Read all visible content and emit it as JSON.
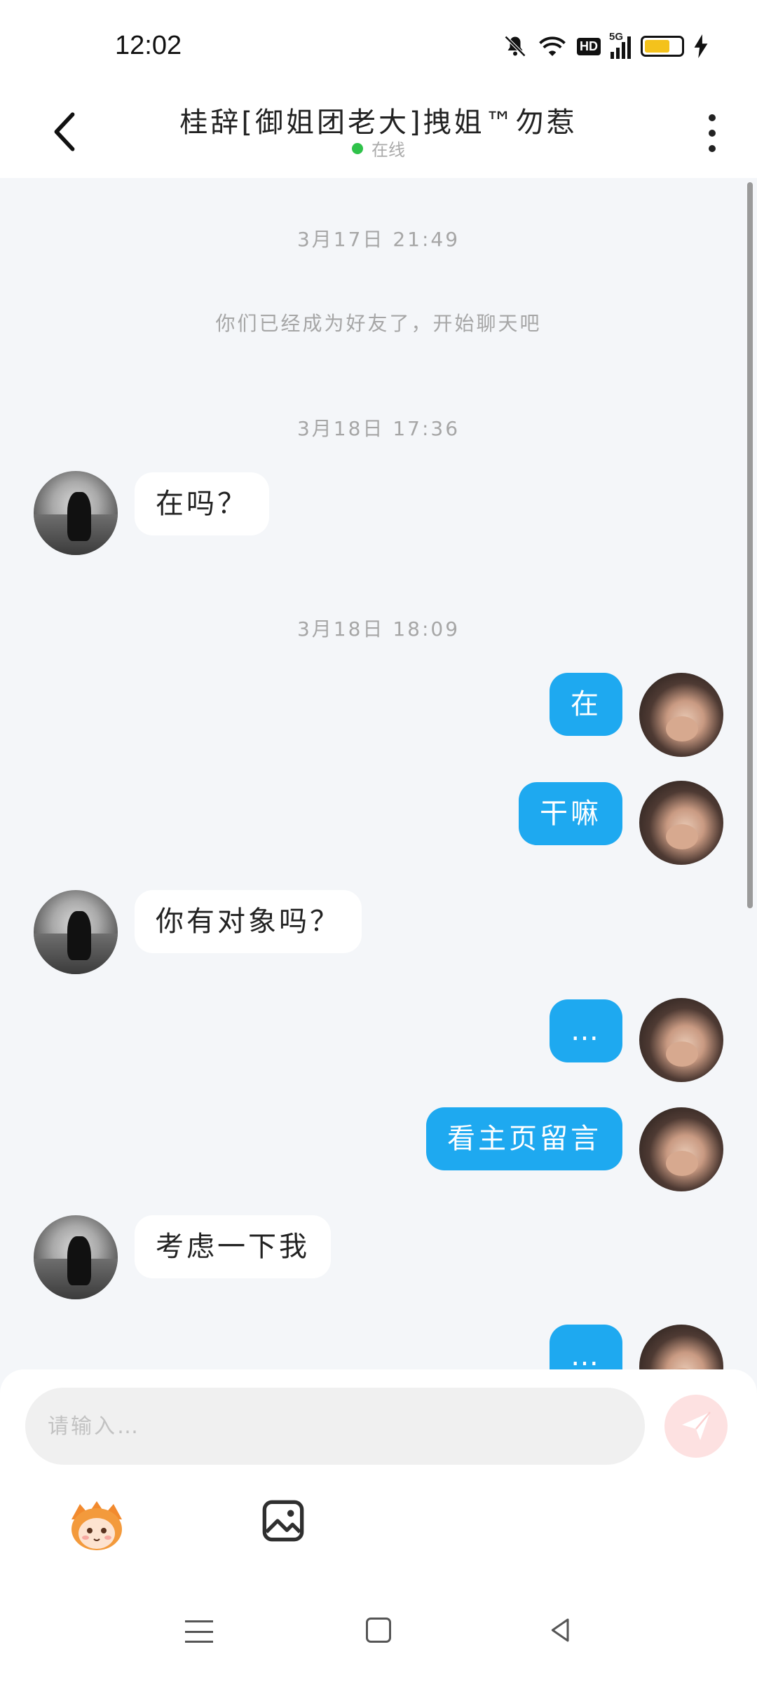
{
  "status_bar": {
    "time": "12:02",
    "icons": [
      "mute-icon",
      "wifi-icon",
      "hd-icon",
      "signal-5g-icon",
      "battery-icon",
      "charging-icon"
    ],
    "hd_label": "HD",
    "network_label": "5G",
    "battery_color": "#f4c21c"
  },
  "header": {
    "title": "桂辞[御姐团老大]拽姐™勿惹",
    "status": "在线",
    "status_color": "#2fc24a"
  },
  "chat": {
    "messages": [
      {
        "type": "timestamp",
        "text": "3月17日 21:49"
      },
      {
        "type": "system",
        "text": "你们已经成为好友了，开始聊天吧"
      },
      {
        "type": "timestamp",
        "text": "3月18日 17:36"
      },
      {
        "type": "incoming",
        "text": "在吗？"
      },
      {
        "type": "timestamp",
        "text": "3月18日 18:09"
      },
      {
        "type": "outgoing",
        "text": "在"
      },
      {
        "type": "outgoing",
        "text": "干嘛"
      },
      {
        "type": "incoming",
        "text": "你有对象吗？"
      },
      {
        "type": "outgoing",
        "text": "…"
      },
      {
        "type": "outgoing",
        "text": "看主页留言"
      },
      {
        "type": "incoming",
        "text": "考虑一下我"
      },
      {
        "type": "outgoing",
        "text": "…"
      }
    ],
    "outgoing_bubble_color": "#1ea9f0",
    "incoming_bubble_color": "#ffffff"
  },
  "composer": {
    "placeholder": "请输入…",
    "send_icon": "send-icon",
    "tools": [
      "emoji-sticker-icon",
      "image-icon"
    ]
  },
  "nav_bar": {
    "buttons": [
      "menu-icon",
      "home-icon",
      "back-icon"
    ]
  }
}
